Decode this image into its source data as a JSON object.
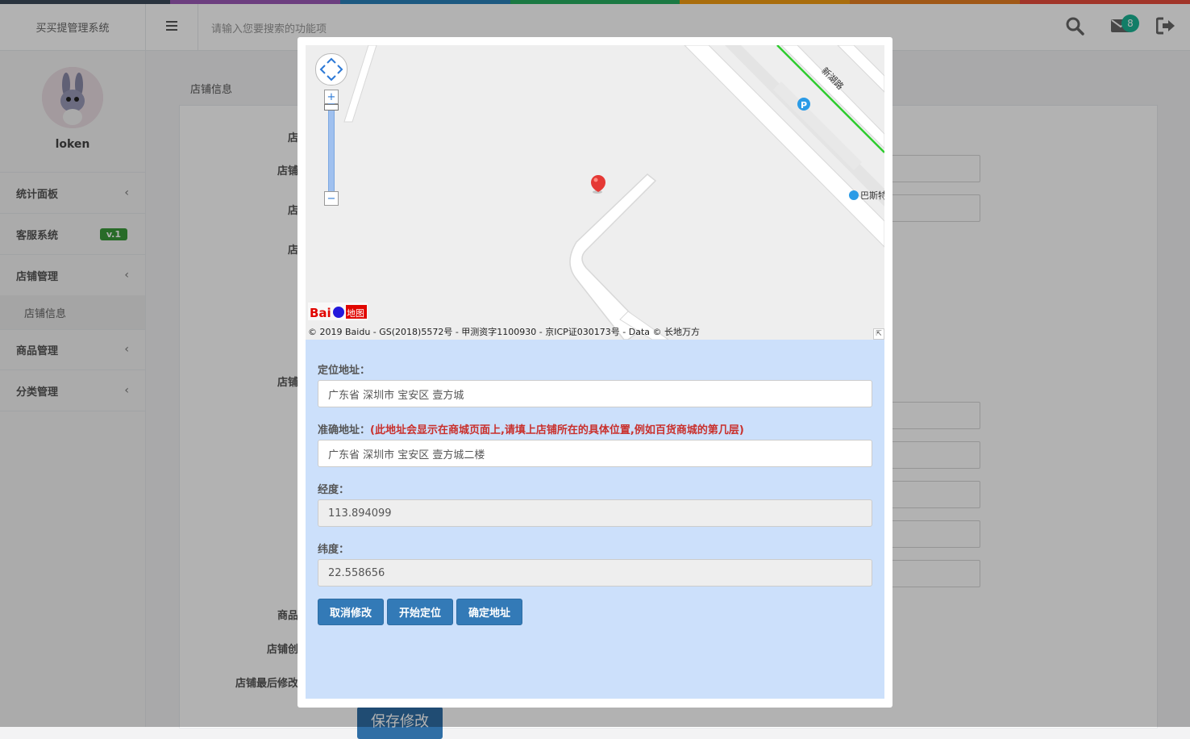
{
  "app": {
    "title": "买买提管理系统",
    "search_placeholder": "请输入您要搜索的功能项",
    "mail_count": "8",
    "accent_colors": [
      "#3c4a5a",
      "#9b59b6",
      "#2980b9",
      "#27ae60",
      "#f39c12",
      "#e67e22",
      "#e74c3c"
    ]
  },
  "icons": {
    "menu": "hamburger-menu-icon",
    "search": "search-icon",
    "mail": "envelope-icon",
    "logout": "logout-icon",
    "chevron": "chevron-left-icon"
  },
  "sidebar": {
    "username": "loken",
    "items": [
      {
        "label": "统计面板",
        "chevron": "‹"
      },
      {
        "label": "客服系统",
        "badge": "v.1"
      },
      {
        "label": "店铺管理",
        "chevron": "‹"
      },
      {
        "label": "店铺信息"
      },
      {
        "label": "商品管理",
        "chevron": "‹"
      },
      {
        "label": "分类管理",
        "chevron": "‹"
      }
    ]
  },
  "main": {
    "breadcrumb": "店铺信息",
    "visible_labels": [
      "店",
      "店铺",
      "店",
      "店",
      "店铺",
      "商品",
      "店铺创",
      "店铺最后修改"
    ],
    "save_button": "保存修改"
  },
  "modal": {
    "map": {
      "copyright": "© 2019 Baidu - GS(2018)5572号 - 甲测资字1100930 - 京ICP证030173号 - Data © 长地万方",
      "road_label": "新湖路",
      "bus_label": "巴斯特",
      "logo_text": "Bai地图",
      "zoom_in": "+",
      "zoom_out": "−"
    },
    "locate_label": "定位地址：",
    "locate_value": "广东省 深圳市 宝安区 壹方城",
    "exact_label": "准确地址：",
    "exact_hint": "(此地址会显示在商城页面上,请填上店铺所在的具体位置,例如百货商城的第几层)",
    "exact_value": "广东省 深圳市 宝安区 壹方城二楼",
    "lng_label": "经度：",
    "lng_value": "113.894099",
    "lat_label": "纬度：",
    "lat_value": "22.558656",
    "buttons": {
      "cancel": "取消修改",
      "locate": "开始定位",
      "confirm": "确定地址"
    }
  }
}
